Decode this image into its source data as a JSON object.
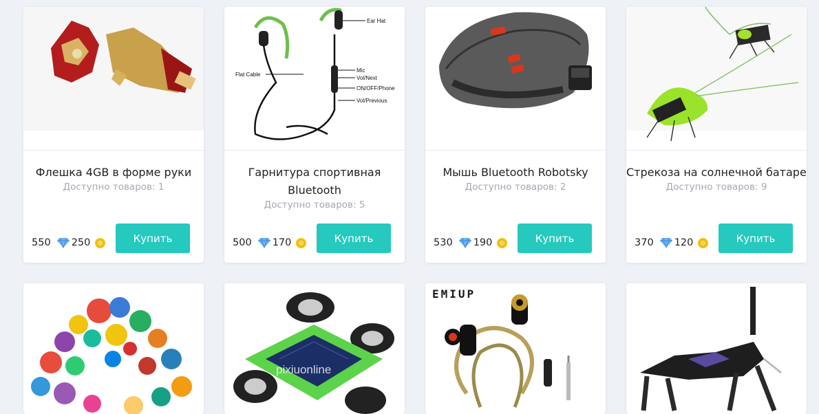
{
  "products_row1": [
    {
      "title": "Флешка 4GB в форме руки",
      "availability": "Доступно товаров: 1",
      "price": "550",
      "gems": "250",
      "buy_label": "Купить"
    },
    {
      "title": "Гарнитура спортивная Bluetooth",
      "availability": "Доступно товаров: 5",
      "price": "500",
      "gems": "170",
      "buy_label": "Купить"
    },
    {
      "title": "Мышь Bluetooth Robotsky",
      "availability": "Доступно товаров: 2",
      "price": "530",
      "gems": "190",
      "buy_label": "Купить"
    },
    {
      "title": "Стрекоза на солнечной батарее",
      "availability": "Доступно товаров: 9",
      "price": "370",
      "gems": "120",
      "buy_label": "Купить"
    }
  ],
  "image_text": {
    "headphone_labels": [
      "Ear Hat",
      "Flat Cable",
      "Mic",
      "Vol/Next",
      "ON/OFF/Phone",
      "Vol/Previous"
    ],
    "brand": "EMIUP",
    "watermark": "pixiuonline"
  },
  "colors": {
    "accent": "#25c9be",
    "gem": "#5aa6f0",
    "coin": "#f5c518"
  },
  "icons": {
    "gem": "diamond-icon",
    "coin": "coin-icon"
  }
}
